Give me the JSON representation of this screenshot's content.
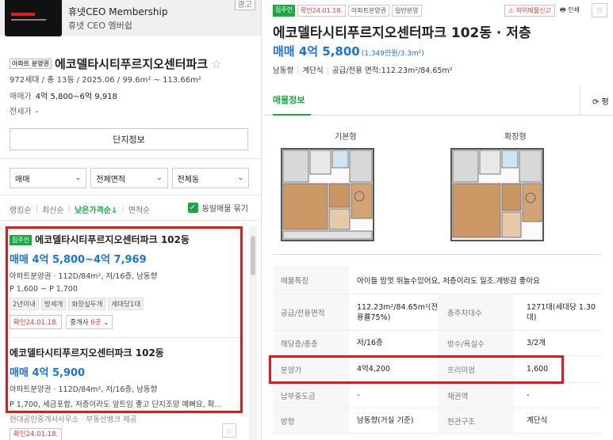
{
  "promo": {
    "title": "휴넷CEO Membership",
    "subtitle": "휴넷 CEO 멤버쉽",
    "close": "광고"
  },
  "complex": {
    "tag": "아파트 분양권",
    "name": "에코델타시티푸르지오센터파크",
    "star": "☆",
    "info": "972세대 / 총 13동 / 2025.06 / 99.6m² ~ 113.66m²",
    "sale_label": "매매가",
    "sale_value": "4억 5,800~6억 9,918",
    "jeonse_label": "전세가",
    "jeonse_value": "-",
    "button": "단지정보"
  },
  "filters": [
    {
      "label": "매매",
      "chev": "⌄"
    },
    {
      "label": "전체면적",
      "chev": "⌄"
    },
    {
      "label": "전체동",
      "chev": "⌄"
    }
  ],
  "sorts": {
    "items": [
      "랭킹순",
      "최신순",
      "낮은가격순↓",
      "면적순"
    ],
    "active_index": 2,
    "same_listing": "동일매물 묶기",
    "check": "✓"
  },
  "listings": [
    {
      "tag": "집주인",
      "title": "에코델타시티푸르지오센터파크 102동",
      "price": "매매 4억 5,800~4억 7,969",
      "desc1": "아파트분양권 · 112D/84m², 저/16층, 남동향",
      "desc2": "P 1,600 ~ P 1,700",
      "chips": [
        "2년이내",
        "방세개",
        "화장실두개",
        "세대당1대"
      ],
      "confirm": "확인24.01.18.",
      "agents_prefix": "중개사 ",
      "agents_count": "6곳",
      "agents_chev": "⌄"
    },
    {
      "title": "에코델타시티푸르지오센터파크 102동",
      "price": "매매 4억 5,900",
      "desc1": "아파트분양권 · 112D/84m², 저/16층, 남동향",
      "desc2": "P 1,700, 세금포함, 저층이라도 앞트임 좋고 단지조망 예뻐요, 확...",
      "desc3": "현대공인중개사사무소 · 부동산뱅크 제공",
      "confirm": "확인24.01.18."
    }
  ],
  "detail": {
    "tags": [
      "집주인",
      "확인24.01.18.",
      "아파트분양권",
      "일반분양"
    ],
    "report": "허위매물신고",
    "print": "인쇄",
    "star": "☆",
    "title": "에코델타시티푸르지오센터파크 102동 · 저층",
    "price": "매매 4억 5,800",
    "price_sub": "(1,349만원/3.3m²)",
    "facts": [
      "남동향",
      "계단식",
      "공급/전용 면적:112.23m²/84.65m²"
    ],
    "tab": "매물정보",
    "tab_right": "⟳ 평",
    "plan_basic": "기본형",
    "plan_extended": "확장형",
    "rows": [
      {
        "k1": "매물특징",
        "full": "아이들 맘껏 뛰놀수있어요, 저층이라도 일조.개방감 좋아요"
      },
      {
        "k1": "공급/전용면적",
        "v1": "112.23m²/84.65m²(전용률75%)",
        "k2": "총주차대수",
        "v2": "1271대(세대당 1.30대)"
      },
      {
        "k1": "해당층/총층",
        "v1": "저/16층",
        "k2": "방수/욕실수",
        "v2": "3/2개"
      },
      {
        "k1": "분양가",
        "v1": "4억4,200",
        "k2": "프리미엄",
        "v2": "1,600"
      },
      {
        "k1": "납부중도금",
        "v1": "-",
        "k2": "채권액",
        "v2": "-"
      },
      {
        "k1": "방향",
        "v1": "남동향(거실 기준)",
        "k2": "현관구조",
        "v2": "계단식"
      }
    ]
  }
}
